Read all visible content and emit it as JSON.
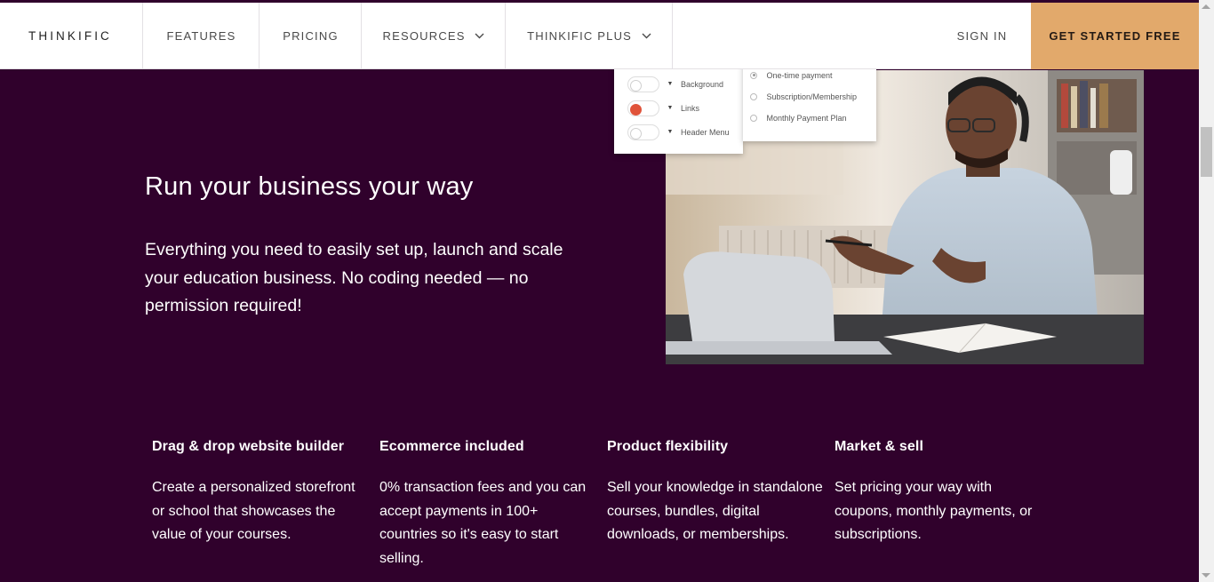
{
  "nav": {
    "logo": "THINKIFIC",
    "items": [
      {
        "label": "FEATURES"
      },
      {
        "label": "PRICING"
      },
      {
        "label": "RESOURCES"
      },
      {
        "label": "THINKIFIC PLUS"
      }
    ],
    "sign_in": "SIGN IN",
    "cta": "GET STARTED FREE"
  },
  "hero": {
    "title": "Run your business your way",
    "description": "Everything you need to easily set up, launch and scale your education business. No coding needed — no permission required!"
  },
  "settings_card": {
    "rows": [
      {
        "label": "Background",
        "swatch": "#ffffff"
      },
      {
        "label": "Links",
        "swatch": "#e0533a"
      },
      {
        "label": "Header Menu",
        "swatch": "#ffffff"
      }
    ]
  },
  "payment_card": {
    "options": [
      {
        "label": "One-time payment",
        "selected": true
      },
      {
        "label": "Subscription/Membership",
        "selected": false
      },
      {
        "label": "Monthly Payment Plan",
        "selected": false
      }
    ]
  },
  "features": [
    {
      "title": "Drag & drop website builder",
      "text": "Create a personalized storefront or school that showcases the value of your courses."
    },
    {
      "title": "Ecommerce included",
      "text": "0% transaction fees and you can accept payments in 100+ countries so it's easy to start selling."
    },
    {
      "title": "Product flexibility",
      "text": "Sell your knowledge in standalone courses, bundles, digital downloads, or memberships."
    },
    {
      "title": "Market & sell",
      "text": "Set pricing your way with coupons, monthly payments, or subscriptions."
    }
  ],
  "colors": {
    "background": "#30012c",
    "cta": "#e2a96b",
    "link_swatch": "#e0533a"
  }
}
